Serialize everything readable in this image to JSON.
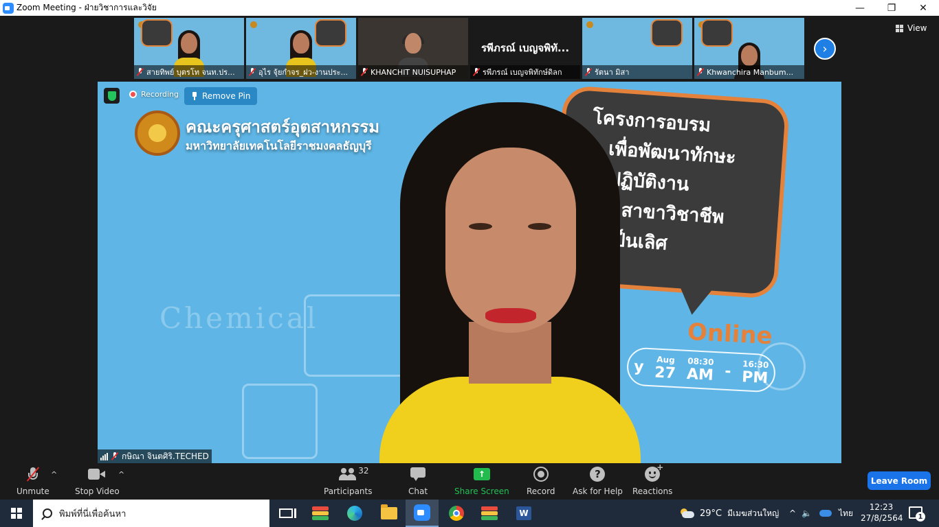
{
  "window": {
    "title": "Zoom Meeting - ฝ่ายวิชาการและวิจัย",
    "minimize": "—",
    "maximize": "❐",
    "close": "✕"
  },
  "top_bar": {
    "view_label": "View",
    "next_page_glyph": "›"
  },
  "gallery": [
    {
      "name": "สายทิพย์ บุตรโท จนท.ปร...",
      "video": true
    },
    {
      "name": "อุไร จุ้ยกำจร_ฝว-งานประ...",
      "video": true
    },
    {
      "name": "KHANCHIT NUISUPHAP",
      "video": true
    },
    {
      "name": "รพีภรณ์ เบญจพิทักษ์ดิลก",
      "center_label": "รพีภรณ์ เบญจพิทั...",
      "video": false
    },
    {
      "name": "รัตนา มิสา",
      "video": true
    },
    {
      "name": "Khwanchira Manbum...",
      "video": true
    }
  ],
  "main_video": {
    "recording_label": "Recording",
    "remove_pin_label": "Remove Pin",
    "speaker_name": "กษิณา จินตศิริ.TECHED",
    "background": {
      "faculty": "คณะครุศาสตร์อุตสาหกรรม",
      "university": "มหาวิทยาลัยเทคโนโลยีราชมงคลธัญบุรี",
      "board_lines": [
        "โครงการอบรม",
        "เพื่อพัฒนาทักษะ",
        "ารปฏิบัติงาน",
        "ตามสาขาวิชาชีพ",
        "ามเป็นเลิศ"
      ],
      "online": "Online",
      "date_left": "y",
      "date_month": "Aug",
      "date_day": "27",
      "time_start": "08:30",
      "time_end": "16:30",
      "am": "AM",
      "pm": "PM",
      "chemical": "Chemical"
    }
  },
  "toolbar": {
    "unmute": "Unmute",
    "stop_video": "Stop Video",
    "participants": "Participants",
    "participants_count": "32",
    "chat": "Chat",
    "share_screen": "Share Screen",
    "record": "Record",
    "ask_help": "Ask for Help",
    "reactions": "Reactions",
    "leave_room": "Leave Room",
    "caret": "^",
    "help_glyph": "?",
    "share_glyph": "↑",
    "react_plus": "+"
  },
  "taskbar": {
    "search_placeholder": "พิมพ์ที่นี่เพื่อค้นหา",
    "weather_temp": "29°C",
    "weather_desc": "มีเมฆส่วนใหญ่",
    "caret": "^",
    "speaker": "🔈",
    "language": "ไทย",
    "time": "12:23",
    "date": "27/8/2564",
    "notification_count": "1",
    "word_glyph": "W"
  },
  "colors": {
    "accent_blue": "#1a73e8",
    "share_green": "#22bb4e",
    "muted_red": "#e02828"
  }
}
